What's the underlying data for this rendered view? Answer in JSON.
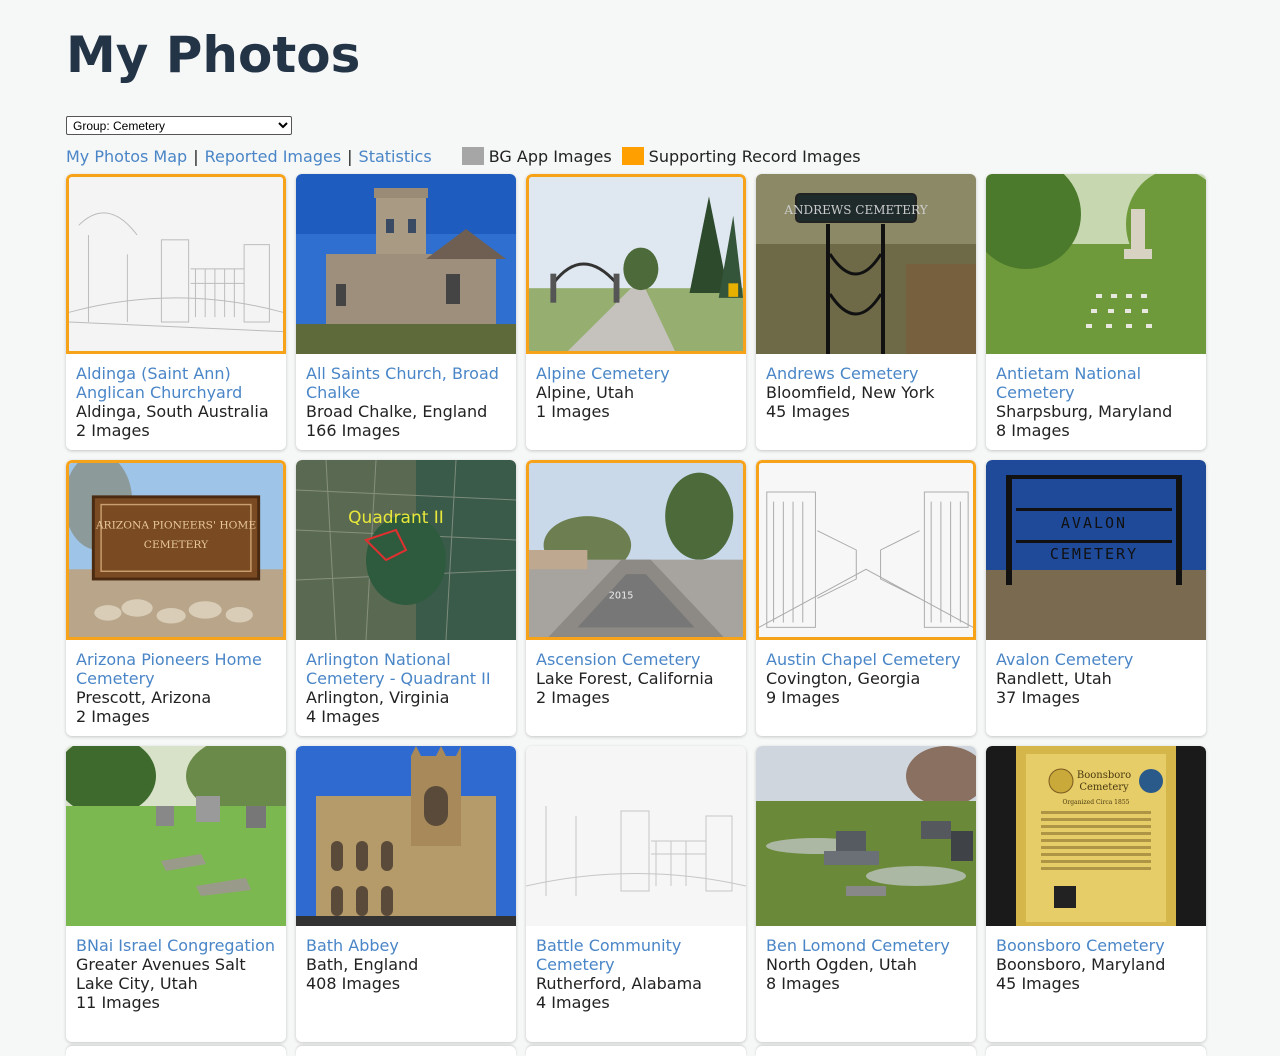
{
  "page": {
    "title": "My Photos"
  },
  "group_select": {
    "value": "Group: Cemetery"
  },
  "toolbar": {
    "links": [
      "My Photos Map",
      "Reported Images",
      "Statistics"
    ],
    "separator": "|",
    "legend": [
      {
        "label": "BG App Images",
        "color": "#a6a6a6"
      },
      {
        "label": "Supporting Record Images",
        "color": "#ff9f00"
      }
    ]
  },
  "colors": {
    "link": "#4a86c7",
    "supporting_border": "#f7a31a",
    "title": "#243447"
  },
  "cards": [
    {
      "name": "Aldinga (Saint Ann) Anglican Churchyard",
      "place": "Aldinga, South Australia",
      "count": "2 Images",
      "supporting": true,
      "thumb": "sketch-gate"
    },
    {
      "name": "All Saints Church, Broad Chalke",
      "place": "Broad Chalke, England",
      "count": "166 Images",
      "supporting": false,
      "thumb": "church"
    },
    {
      "name": "Alpine Cemetery",
      "place": "Alpine, Utah",
      "count": "1 Images",
      "supporting": true,
      "thumb": "arch-road"
    },
    {
      "name": "Andrews Cemetery",
      "place": "Bloomfield, New York",
      "count": "45 Images",
      "supporting": false,
      "thumb": "iron-sign"
    },
    {
      "name": "Antietam National Cemetery",
      "place": "Sharpsburg, Maryland",
      "count": "8 Images",
      "supporting": false,
      "thumb": "monument-lawn"
    },
    {
      "name": "Arizona Pioneers Home Cemetery",
      "place": "Prescott, Arizona",
      "count": "2 Images",
      "supporting": true,
      "thumb": "wood-sign"
    },
    {
      "name": "Arlington National Cemetery - Quadrant II",
      "place": "Arlington, Virginia",
      "count": "4 Images",
      "supporting": false,
      "thumb": "map"
    },
    {
      "name": "Ascension Cemetery",
      "place": "Lake Forest, California",
      "count": "2 Images",
      "supporting": true,
      "thumb": "street"
    },
    {
      "name": "Austin Chapel Cemetery",
      "place": "Covington, Georgia",
      "count": "9 Images",
      "supporting": true,
      "thumb": "sketch-gates"
    },
    {
      "name": "Avalon Cemetery",
      "place": "Randlett, Utah",
      "count": "37 Images",
      "supporting": false,
      "thumb": "iron-arch"
    },
    {
      "name": "BNai Israel Congregation",
      "place": "Greater Avenues Salt Lake City, Utah",
      "count": "11 Images",
      "supporting": false,
      "thumb": "graves-lawn"
    },
    {
      "name": "Bath Abbey",
      "place": "Bath, England",
      "count": "408 Images",
      "supporting": false,
      "thumb": "abbey"
    },
    {
      "name": "Battle Community Cemetery",
      "place": "Rutherford, Alabama",
      "count": "4 Images",
      "supporting": false,
      "thumb": "sketch-gate-light"
    },
    {
      "name": "Ben Lomond Cemetery",
      "place": "North Ogden, Utah",
      "count": "8 Images",
      "supporting": false,
      "thumb": "headstones"
    },
    {
      "name": "Boonsboro Cemetery",
      "place": "Boonsboro, Maryland",
      "count": "45 Images",
      "supporting": false,
      "thumb": "plaque"
    }
  ],
  "thumb_text": {
    "andrews": "ANDREWS CEMETERY",
    "arizona_line1": "ARIZONA PIONEERS' HOME",
    "arizona_line2": "CEMETERY",
    "quadrant": "Quadrant II",
    "road_marking": "2015",
    "avalon_line1": "AVALON",
    "avalon_line2": "CEMETERY",
    "boonsboro_line1": "Boonsboro",
    "boonsboro_line2": "Cemetery",
    "boonsboro_sub": "Organized Circa 1855"
  }
}
